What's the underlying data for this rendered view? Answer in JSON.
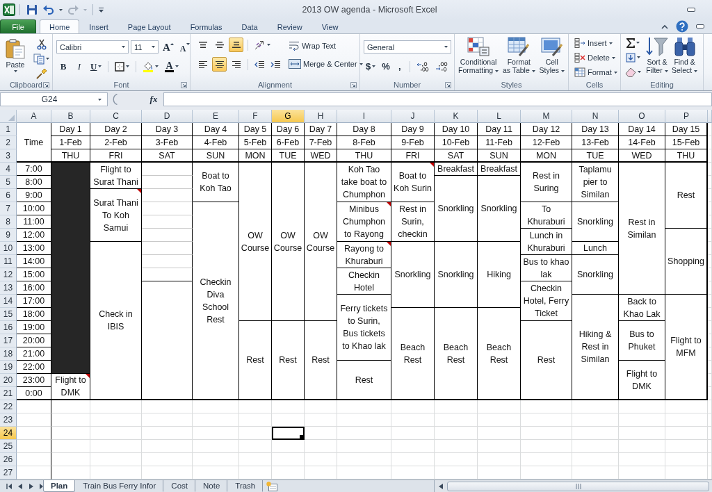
{
  "window": {
    "title": "2013 OW agenda - Microsoft Excel"
  },
  "ribbon_tabs": [
    {
      "label": "File",
      "kind": "file",
      "selected": false
    },
    {
      "label": "Home",
      "kind": "tab",
      "selected": true
    },
    {
      "label": "Insert",
      "kind": "tab",
      "selected": false
    },
    {
      "label": "Page Layout",
      "kind": "tab",
      "selected": false
    },
    {
      "label": "Formulas",
      "kind": "tab",
      "selected": false
    },
    {
      "label": "Data",
      "kind": "tab",
      "selected": false
    },
    {
      "label": "Review",
      "kind": "tab",
      "selected": false
    },
    {
      "label": "View",
      "kind": "tab",
      "selected": false
    }
  ],
  "clipboard": {
    "label": "Clipboard",
    "paste": "Paste"
  },
  "font": {
    "label": "Font",
    "name": "Calibri",
    "size": "11",
    "grow": "A",
    "shrink": "A",
    "bold": "B",
    "italic": "I",
    "underline": "U",
    "font_color_button": "A"
  },
  "alignment": {
    "label": "Alignment",
    "vertical": [
      {
        "kind": "top",
        "selected": false
      },
      {
        "kind": "middle",
        "selected": false
      },
      {
        "kind": "bottom",
        "selected": true
      }
    ],
    "horizontal": [
      {
        "kind": "left",
        "selected": false
      },
      {
        "kind": "center",
        "selected": true
      },
      {
        "kind": "right",
        "selected": false
      }
    ],
    "wrap_text": "Wrap Text",
    "merge": "Merge & Center"
  },
  "number": {
    "label": "Number",
    "format": "General",
    "currency": "$",
    "percent": "%",
    "comma": ","
  },
  "styles": {
    "label": "Styles",
    "buttons": [
      {
        "kind": "conditional",
        "lines": [
          "Conditional",
          "Formatting"
        ]
      },
      {
        "kind": "table",
        "lines": [
          "Format",
          "as Table"
        ]
      },
      {
        "kind": "cell",
        "lines": [
          "Cell",
          "Styles"
        ]
      }
    ]
  },
  "cells": {
    "label": "Cells",
    "buttons": [
      {
        "kind": "insert",
        "label": "Insert"
      },
      {
        "kind": "delete",
        "label": "Delete"
      },
      {
        "kind": "format",
        "label": "Format"
      }
    ]
  },
  "editing": {
    "label": "Editing",
    "buttons": [
      {
        "kind": "sort",
        "lines": [
          "Sort &",
          "Filter"
        ]
      },
      {
        "kind": "find",
        "lines": [
          "Find &",
          "Select"
        ]
      }
    ]
  },
  "formula_bar": {
    "name_box": "G24",
    "function_button": "fx"
  },
  "sheet": {
    "columns": [
      {
        "letter": "A",
        "selected": false
      },
      {
        "letter": "B",
        "selected": false
      },
      {
        "letter": "C",
        "selected": false
      },
      {
        "letter": "D",
        "selected": false
      },
      {
        "letter": "E",
        "selected": false
      },
      {
        "letter": "F",
        "selected": false
      },
      {
        "letter": "G",
        "selected": true
      },
      {
        "letter": "H",
        "selected": false
      },
      {
        "letter": "I",
        "selected": false
      },
      {
        "letter": "J",
        "selected": false
      },
      {
        "letter": "K",
        "selected": false
      },
      {
        "letter": "L",
        "selected": false
      },
      {
        "letter": "M",
        "selected": false
      },
      {
        "letter": "N",
        "selected": false
      },
      {
        "letter": "O",
        "selected": false
      },
      {
        "letter": "P",
        "selected": false
      }
    ],
    "rows": [
      {
        "number": "1",
        "selected": false
      },
      {
        "number": "2",
        "selected": false
      },
      {
        "number": "3",
        "selected": false
      },
      {
        "number": "4",
        "selected": false
      },
      {
        "number": "5",
        "selected": false
      },
      {
        "number": "6",
        "selected": false
      },
      {
        "number": "7",
        "selected": false
      },
      {
        "number": "8",
        "selected": false
      },
      {
        "number": "9",
        "selected": false
      },
      {
        "number": "10",
        "selected": false
      },
      {
        "number": "11",
        "selected": false
      },
      {
        "number": "12",
        "selected": false
      },
      {
        "number": "13",
        "selected": false
      },
      {
        "number": "14",
        "selected": false
      },
      {
        "number": "15",
        "selected": false
      },
      {
        "number": "16",
        "selected": false
      },
      {
        "number": "17",
        "selected": false
      },
      {
        "number": "18",
        "selected": false
      },
      {
        "number": "19",
        "selected": false
      },
      {
        "number": "20",
        "selected": false
      },
      {
        "number": "21",
        "selected": false
      },
      {
        "number": "22",
        "selected": false
      },
      {
        "number": "23",
        "selected": false
      },
      {
        "number": "24",
        "selected": true
      },
      {
        "number": "25",
        "selected": false
      },
      {
        "number": "26",
        "selected": false
      },
      {
        "number": "27",
        "selected": false
      }
    ],
    "time_header": "Time",
    "times": [
      "7:00",
      "8:00",
      "9:00",
      "10:00",
      "11:00",
      "12:00",
      "13:00",
      "14:00",
      "15:00",
      "16:00",
      "17:00",
      "18:00",
      "19:00",
      "20:00",
      "21:00",
      "22:00",
      "23:00",
      "0:00"
    ],
    "days": [
      {
        "day": "Day 1",
        "date": "1-Feb",
        "weekday": "THU",
        "cells": [
          {
            "kind": "shaded"
          },
          {
            "kind": "joined"
          },
          {
            "kind": "joined"
          },
          {
            "kind": "joined"
          },
          {
            "kind": "joined"
          },
          {
            "kind": "joined"
          },
          {
            "kind": "joined"
          },
          {
            "kind": "joined"
          },
          {
            "kind": "joined"
          },
          {
            "kind": "joined"
          },
          {
            "kind": "joined"
          },
          {
            "kind": "joined"
          },
          {
            "kind": "joined"
          },
          {
            "kind": "joined"
          },
          {
            "kind": "joined"
          },
          {
            "kind": "joined"
          },
          {
            "kind": "text",
            "text": "Flight to DMK",
            "comment": true
          },
          {
            "kind": "joined"
          }
        ]
      },
      {
        "day": "Day 2",
        "date": "2-Feb",
        "weekday": "FRI",
        "cells": [
          {
            "kind": "text",
            "text": "Flight to Surat Thani",
            "comment": false
          },
          {
            "kind": "joined"
          },
          {
            "kind": "text",
            "text": "Surat Thani To Koh Samui",
            "comment": true
          },
          {
            "kind": "joined"
          },
          {
            "kind": "joined"
          },
          {
            "kind": "joined"
          },
          {
            "kind": "text",
            "text": "Check in IBIS",
            "comment": false
          },
          {
            "kind": "joined"
          },
          {
            "kind": "joined"
          },
          {
            "kind": "joined"
          },
          {
            "kind": "joined"
          },
          {
            "kind": "joined"
          },
          {
            "kind": "joined"
          },
          {
            "kind": "joined"
          },
          {
            "kind": "joined"
          },
          {
            "kind": "joined"
          },
          {
            "kind": "joined"
          },
          {
            "kind": "joined"
          }
        ]
      },
      {
        "day": "Day 3",
        "date": "3-Feb",
        "weekday": "SAT",
        "cells": [
          {
            "kind": "empty"
          },
          {
            "kind": "empty"
          },
          {
            "kind": "empty"
          },
          {
            "kind": "empty"
          },
          {
            "kind": "empty"
          },
          {
            "kind": "empty"
          },
          {
            "kind": "empty"
          },
          {
            "kind": "empty"
          },
          {
            "kind": "empty"
          },
          {
            "kind": "empty"
          },
          {
            "kind": "joined"
          },
          {
            "kind": "joined"
          },
          {
            "kind": "joined"
          },
          {
            "kind": "joined"
          },
          {
            "kind": "joined"
          },
          {
            "kind": "joined"
          },
          {
            "kind": "joined"
          },
          {
            "kind": "joined"
          }
        ]
      },
      {
        "day": "Day 4",
        "date": "4-Feb",
        "weekday": "SUN",
        "cells": [
          {
            "kind": "text",
            "text": "Boat to Koh Tao",
            "comment": false
          },
          {
            "kind": "joined"
          },
          {
            "kind": "joined"
          },
          {
            "kind": "text",
            "text": "Checkin Diva School Rest",
            "comment": false
          },
          {
            "kind": "joined"
          },
          {
            "kind": "joined"
          },
          {
            "kind": "joined"
          },
          {
            "kind": "joined"
          },
          {
            "kind": "joined"
          },
          {
            "kind": "joined"
          },
          {
            "kind": "joined"
          },
          {
            "kind": "joined"
          },
          {
            "kind": "joined"
          },
          {
            "kind": "joined"
          },
          {
            "kind": "joined"
          },
          {
            "kind": "joined"
          },
          {
            "kind": "joined"
          },
          {
            "kind": "joined"
          }
        ]
      },
      {
        "day": "Day 5",
        "date": "5-Feb",
        "weekday": "MON",
        "cells": [
          {
            "kind": "text",
            "text": "OW Course",
            "comment": false
          },
          {
            "kind": "joined"
          },
          {
            "kind": "joined"
          },
          {
            "kind": "joined"
          },
          {
            "kind": "joined"
          },
          {
            "kind": "joined"
          },
          {
            "kind": "joined"
          },
          {
            "kind": "joined"
          },
          {
            "kind": "joined"
          },
          {
            "kind": "joined"
          },
          {
            "kind": "joined"
          },
          {
            "kind": "joined"
          },
          {
            "kind": "text",
            "text": "Rest",
            "comment": false
          },
          {
            "kind": "joined"
          },
          {
            "kind": "joined"
          },
          {
            "kind": "joined"
          },
          {
            "kind": "joined"
          },
          {
            "kind": "joined"
          }
        ]
      },
      {
        "day": "Day 6",
        "date": "6-Feb",
        "weekday": "TUE",
        "cells": [
          {
            "kind": "text",
            "text": "OW Course",
            "comment": false
          },
          {
            "kind": "joined"
          },
          {
            "kind": "joined"
          },
          {
            "kind": "joined"
          },
          {
            "kind": "joined"
          },
          {
            "kind": "joined"
          },
          {
            "kind": "joined"
          },
          {
            "kind": "joined"
          },
          {
            "kind": "joined"
          },
          {
            "kind": "joined"
          },
          {
            "kind": "joined"
          },
          {
            "kind": "joined"
          },
          {
            "kind": "text",
            "text": "Rest",
            "comment": false
          },
          {
            "kind": "joined"
          },
          {
            "kind": "joined"
          },
          {
            "kind": "joined"
          },
          {
            "kind": "joined"
          },
          {
            "kind": "joined"
          }
        ]
      },
      {
        "day": "Day 7",
        "date": "7-Feb",
        "weekday": "WED",
        "cells": [
          {
            "kind": "text",
            "text": "OW Course",
            "comment": false
          },
          {
            "kind": "joined"
          },
          {
            "kind": "joined"
          },
          {
            "kind": "joined"
          },
          {
            "kind": "joined"
          },
          {
            "kind": "joined"
          },
          {
            "kind": "joined"
          },
          {
            "kind": "joined"
          },
          {
            "kind": "joined"
          },
          {
            "kind": "joined"
          },
          {
            "kind": "joined"
          },
          {
            "kind": "joined"
          },
          {
            "kind": "text",
            "text": "Rest",
            "comment": false
          },
          {
            "kind": "joined"
          },
          {
            "kind": "joined"
          },
          {
            "kind": "joined"
          },
          {
            "kind": "joined"
          },
          {
            "kind": "joined"
          }
        ]
      },
      {
        "day": "Day 8",
        "date": "8-Feb",
        "weekday": "THU",
        "cells": [
          {
            "kind": "text",
            "text": "Koh Tao take boat to Chumphon",
            "comment": false
          },
          {
            "kind": "joined"
          },
          {
            "kind": "joined"
          },
          {
            "kind": "text",
            "text": "Minibus Chumphon to Rayong",
            "comment": true
          },
          {
            "kind": "joined"
          },
          {
            "kind": "joined"
          },
          {
            "kind": "text",
            "text": "Rayong to Khuraburi",
            "comment": true
          },
          {
            "kind": "joined"
          },
          {
            "kind": "text",
            "text": "Checkin Hotel",
            "comment": false
          },
          {
            "kind": "joined"
          },
          {
            "kind": "text",
            "text": "Ferry tickets to Surin, Bus tickets to Khao lak",
            "comment": false
          },
          {
            "kind": "joined"
          },
          {
            "kind": "joined"
          },
          {
            "kind": "joined"
          },
          {
            "kind": "joined"
          },
          {
            "kind": "text",
            "text": "Rest",
            "comment": false
          },
          {
            "kind": "joined"
          },
          {
            "kind": "joined"
          }
        ]
      },
      {
        "day": "Day 9",
        "date": "9-Feb",
        "weekday": "FRI",
        "cells": [
          {
            "kind": "text",
            "text": "Boat to Koh Surin",
            "comment": true
          },
          {
            "kind": "joined"
          },
          {
            "kind": "joined"
          },
          {
            "kind": "text",
            "text": "Rest in Surin, checkin",
            "comment": false
          },
          {
            "kind": "joined"
          },
          {
            "kind": "joined"
          },
          {
            "kind": "text",
            "text": "Snorkling",
            "comment": false
          },
          {
            "kind": "joined"
          },
          {
            "kind": "joined"
          },
          {
            "kind": "joined"
          },
          {
            "kind": "joined"
          },
          {
            "kind": "text",
            "text": "Beach Rest",
            "comment": false
          },
          {
            "kind": "joined"
          },
          {
            "kind": "joined"
          },
          {
            "kind": "joined"
          },
          {
            "kind": "joined"
          },
          {
            "kind": "joined"
          },
          {
            "kind": "joined"
          }
        ]
      },
      {
        "day": "Day 10",
        "date": "10-Feb",
        "weekday": "SAT",
        "cells": [
          {
            "kind": "text",
            "text": "Breakfast",
            "comment": false
          },
          {
            "kind": "text",
            "text": "Snorkling",
            "comment": false
          },
          {
            "kind": "joined"
          },
          {
            "kind": "joined"
          },
          {
            "kind": "joined"
          },
          {
            "kind": "joined"
          },
          {
            "kind": "text",
            "text": "Snorkling",
            "comment": false
          },
          {
            "kind": "joined"
          },
          {
            "kind": "joined"
          },
          {
            "kind": "joined"
          },
          {
            "kind": "joined"
          },
          {
            "kind": "text",
            "text": "Beach Rest",
            "comment": false
          },
          {
            "kind": "joined"
          },
          {
            "kind": "joined"
          },
          {
            "kind": "joined"
          },
          {
            "kind": "joined"
          },
          {
            "kind": "joined"
          },
          {
            "kind": "joined"
          }
        ]
      },
      {
        "day": "Day 11",
        "date": "11-Feb",
        "weekday": "SUN",
        "cells": [
          {
            "kind": "text",
            "text": "Breakfast",
            "comment": false
          },
          {
            "kind": "text",
            "text": "Snorkling",
            "comment": false
          },
          {
            "kind": "joined"
          },
          {
            "kind": "joined"
          },
          {
            "kind": "joined"
          },
          {
            "kind": "joined"
          },
          {
            "kind": "text",
            "text": "Hiking",
            "comment": false
          },
          {
            "kind": "joined"
          },
          {
            "kind": "joined"
          },
          {
            "kind": "joined"
          },
          {
            "kind": "joined"
          },
          {
            "kind": "text",
            "text": "Beach Rest",
            "comment": false
          },
          {
            "kind": "joined"
          },
          {
            "kind": "joined"
          },
          {
            "kind": "joined"
          },
          {
            "kind": "joined"
          },
          {
            "kind": "joined"
          },
          {
            "kind": "joined"
          }
        ]
      },
      {
        "day": "Day 12",
        "date": "12-Feb",
        "weekday": "MON",
        "cells": [
          {
            "kind": "text",
            "text": "Rest in Suring",
            "comment": false
          },
          {
            "kind": "joined"
          },
          {
            "kind": "joined"
          },
          {
            "kind": "text",
            "text": "To Khuraburi",
            "comment": false
          },
          {
            "kind": "joined"
          },
          {
            "kind": "text",
            "text": "Lunch in Khuraburi",
            "comment": false
          },
          {
            "kind": "joined"
          },
          {
            "kind": "text",
            "text": "Bus to khao lak",
            "comment": false
          },
          {
            "kind": "joined"
          },
          {
            "kind": "text",
            "text": "Checkin Hotel, Ferry Ticket",
            "comment": false
          },
          {
            "kind": "joined"
          },
          {
            "kind": "joined"
          },
          {
            "kind": "text",
            "text": "Rest",
            "comment": false
          },
          {
            "kind": "joined"
          },
          {
            "kind": "joined"
          },
          {
            "kind": "joined"
          },
          {
            "kind": "joined"
          },
          {
            "kind": "joined"
          }
        ]
      },
      {
        "day": "Day 13",
        "date": "13-Feb",
        "weekday": "TUE",
        "cells": [
          {
            "kind": "text",
            "text": "Taplamu pier to Similan",
            "comment": false
          },
          {
            "kind": "joined"
          },
          {
            "kind": "joined"
          },
          {
            "kind": "text",
            "text": "Snorkling",
            "comment": false
          },
          {
            "kind": "joined"
          },
          {
            "kind": "joined"
          },
          {
            "kind": "text",
            "text": "Lunch",
            "comment": false
          },
          {
            "kind": "text",
            "text": "Snorkling",
            "comment": false
          },
          {
            "kind": "joined"
          },
          {
            "kind": "joined"
          },
          {
            "kind": "text",
            "text": "Hiking & Rest in Similan",
            "comment": false
          },
          {
            "kind": "joined"
          },
          {
            "kind": "joined"
          },
          {
            "kind": "joined"
          },
          {
            "kind": "joined"
          },
          {
            "kind": "joined"
          },
          {
            "kind": "joined"
          },
          {
            "kind": "joined"
          }
        ]
      },
      {
        "day": "Day 14",
        "date": "14-Feb",
        "weekday": "WED",
        "cells": [
          {
            "kind": "text",
            "text": "Rest in Similan",
            "comment": false
          },
          {
            "kind": "joined"
          },
          {
            "kind": "joined"
          },
          {
            "kind": "joined"
          },
          {
            "kind": "joined"
          },
          {
            "kind": "joined"
          },
          {
            "kind": "joined"
          },
          {
            "kind": "joined"
          },
          {
            "kind": "joined"
          },
          {
            "kind": "joined"
          },
          {
            "kind": "text",
            "text": "Back to Khao Lak",
            "comment": false
          },
          {
            "kind": "joined"
          },
          {
            "kind": "text",
            "text": "Bus to Phuket",
            "comment": false
          },
          {
            "kind": "joined"
          },
          {
            "kind": "joined"
          },
          {
            "kind": "text",
            "text": "Flight to DMK",
            "comment": false
          },
          {
            "kind": "joined"
          },
          {
            "kind": "joined"
          }
        ]
      },
      {
        "day": "Day 15",
        "date": "15-Feb",
        "weekday": "THU",
        "cells": [
          {
            "kind": "text",
            "text": "Rest",
            "comment": false
          },
          {
            "kind": "joined"
          },
          {
            "kind": "joined"
          },
          {
            "kind": "joined"
          },
          {
            "kind": "joined"
          },
          {
            "kind": "text",
            "text": "Shopping",
            "comment": false
          },
          {
            "kind": "joined"
          },
          {
            "kind": "joined"
          },
          {
            "kind": "joined"
          },
          {
            "kind": "joined"
          },
          {
            "kind": "text",
            "text": "Flight to MFM",
            "comment": false
          },
          {
            "kind": "joined"
          },
          {
            "kind": "joined"
          },
          {
            "kind": "joined"
          },
          {
            "kind": "joined"
          },
          {
            "kind": "joined"
          },
          {
            "kind": "joined"
          },
          {
            "kind": "joined"
          }
        ]
      }
    ]
  },
  "sheet_tabs": [
    {
      "label": "Plan",
      "selected": true
    },
    {
      "label": "Train Bus Ferry Infor",
      "selected": false
    },
    {
      "label": "Cost",
      "selected": false
    },
    {
      "label": "Note",
      "selected": false
    },
    {
      "label": "Trash",
      "selected": false
    }
  ]
}
